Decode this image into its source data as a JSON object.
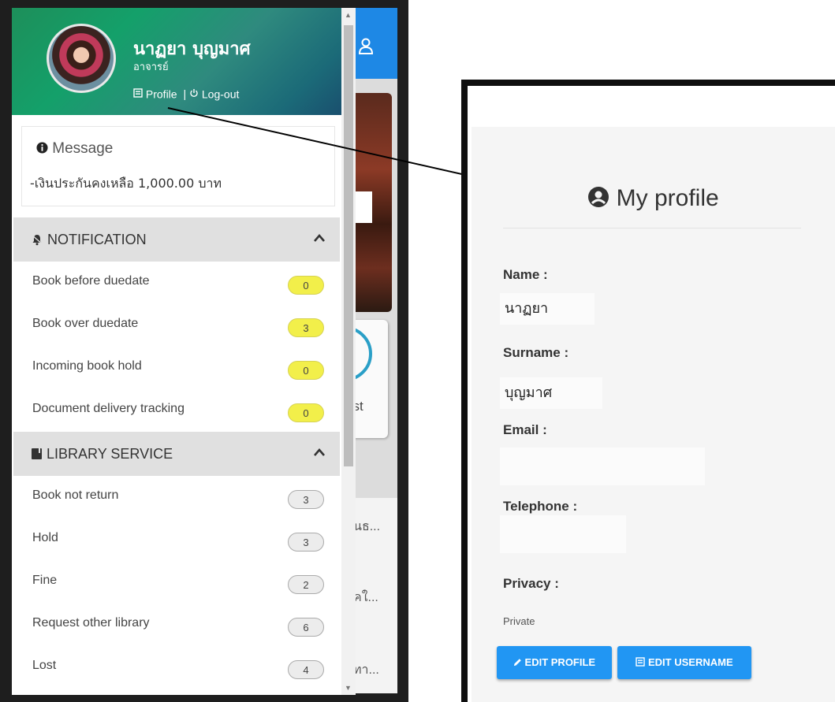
{
  "drawer": {
    "user_name": "นาฏยา บุญมาศ",
    "user_role": "อาจารย์",
    "profile_link": "Profile",
    "separator": "|",
    "logout_link": "Log-out",
    "message_title": "Message",
    "message_text": "-เงินประกันคงเหลือ 1,000.00 บาท"
  },
  "notification": {
    "title": "NOTIFICATION",
    "items": [
      {
        "label": "Book before duedate",
        "count": "0"
      },
      {
        "label": "Book over duedate",
        "count": "3"
      },
      {
        "label": "Incoming book hold",
        "count": "0"
      },
      {
        "label": "Document delivery tracking",
        "count": "0"
      }
    ]
  },
  "library_service": {
    "title": "LIBRARY SERVICE",
    "items": [
      {
        "label": "Book not return",
        "count": "3"
      },
      {
        "label": "Hold",
        "count": "3"
      },
      {
        "label": "Fine",
        "count": "2"
      },
      {
        "label": "Request other library",
        "count": "6"
      },
      {
        "label": "Lost",
        "count": "4"
      }
    ]
  },
  "background_app": {
    "card_text": "est",
    "list_texts": [
      "นธ...",
      "คใ...",
      "ทา..."
    ]
  },
  "profile": {
    "title": "My profile",
    "name_label": "Name :",
    "name_value": "นาฏยา",
    "surname_label": "Surname :",
    "surname_value": "บุญมาศ",
    "email_label": "Email :",
    "email_value": "",
    "telephone_label": "Telephone :",
    "telephone_value": "",
    "privacy_label": "Privacy :",
    "privacy_value": "Private",
    "edit_profile_btn": "EDIT PROFILE",
    "edit_username_btn": "EDIT USERNAME"
  },
  "colors": {
    "accent_blue": "#2196f3",
    "header_green": "#14a06a",
    "badge_yellow": "#f2ef4a",
    "section_gray": "#e0e0e0"
  }
}
